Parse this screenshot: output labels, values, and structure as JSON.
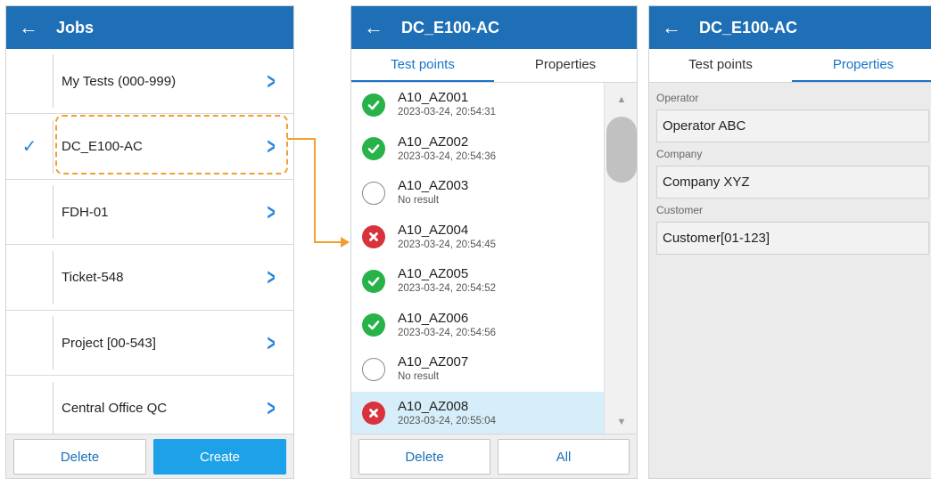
{
  "jobs_panel": {
    "back_icon": "arrow-left-icon",
    "title": "Jobs",
    "items": [
      {
        "label": "My Tests (000-999)",
        "checked": false
      },
      {
        "label": "DC_E100-AC",
        "checked": true
      },
      {
        "label": "FDH-01",
        "checked": false
      },
      {
        "label": "Ticket-548",
        "checked": false
      },
      {
        "label": "Project [00-543]",
        "checked": false
      },
      {
        "label": "Central Office QC",
        "checked": false
      }
    ],
    "check_mark": "✓",
    "chevron": ">",
    "delete_label": "Delete",
    "create_label": "Create"
  },
  "testpoints_panel": {
    "title": "DC_E100-AC",
    "tabs": [
      "Test points",
      "Properties"
    ],
    "active_tab": 0,
    "items": [
      {
        "name": "A10_AZ001",
        "detail": "2023-03-24, 20:54:31",
        "status": "pass"
      },
      {
        "name": "A10_AZ002",
        "detail": "2023-03-24, 20:54:36",
        "status": "pass"
      },
      {
        "name": "A10_AZ003",
        "detail": "No result",
        "status": "none"
      },
      {
        "name": "A10_AZ004",
        "detail": "2023-03-24, 20:54:45",
        "status": "fail"
      },
      {
        "name": "A10_AZ005",
        "detail": "2023-03-24, 20:54:52",
        "status": "pass"
      },
      {
        "name": "A10_AZ006",
        "detail": "2023-03-24, 20:54:56",
        "status": "pass"
      },
      {
        "name": "A10_AZ007",
        "detail": "No result",
        "status": "none"
      },
      {
        "name": "A10_AZ008",
        "detail": "2023-03-24, 20:55:04",
        "status": "fail",
        "selected": true
      }
    ],
    "delete_label": "Delete",
    "all_label": "All"
  },
  "properties_panel": {
    "title": "DC_E100-AC",
    "tabs": [
      "Test points",
      "Properties"
    ],
    "active_tab": 1,
    "fields": [
      {
        "label": "Operator",
        "value": "Operator ABC"
      },
      {
        "label": "Company",
        "value": "Company XYZ"
      },
      {
        "label": "Customer",
        "value": "Customer[01-123]"
      }
    ]
  },
  "colors": {
    "header": "#1e6fb5",
    "accent": "#1a73c7",
    "highlight": "#f0a030",
    "pass": "#27b24a",
    "fail": "#d9323c",
    "selected_row": "#d6eefa"
  }
}
